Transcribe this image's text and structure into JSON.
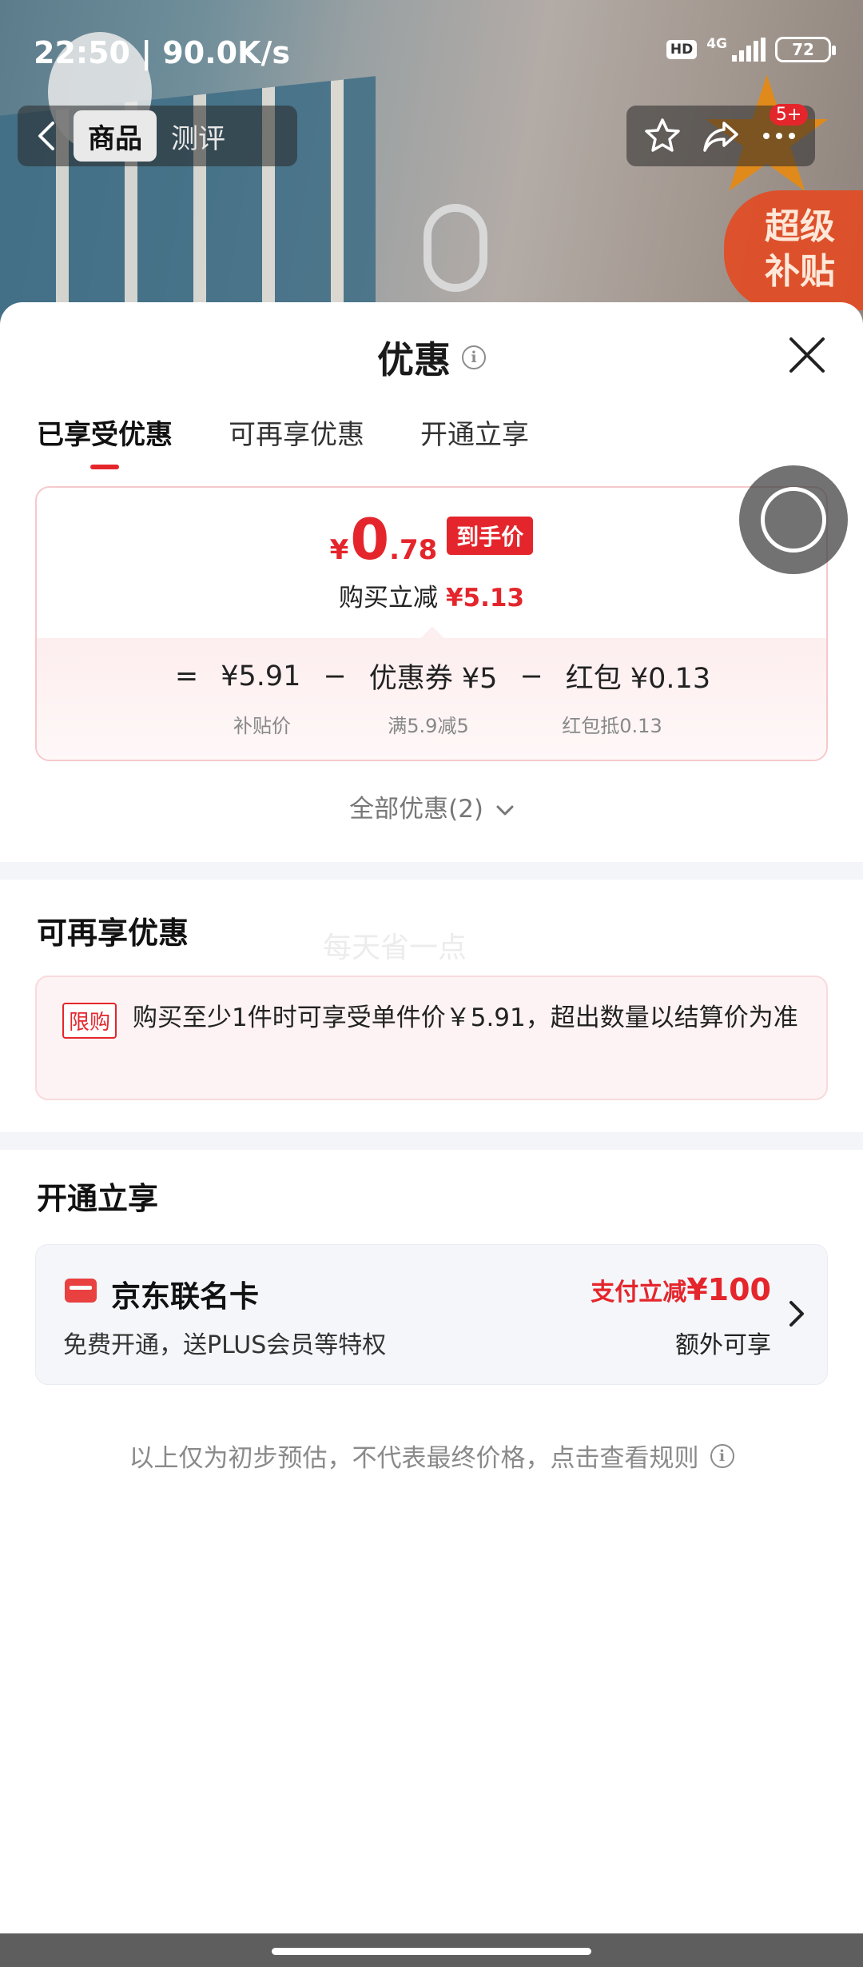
{
  "status_bar": {
    "time": "22:50 | 90.0K/s",
    "hd": "HD",
    "network": "4G",
    "battery": "72"
  },
  "nav": {
    "tab_goods": "商品",
    "tab_review": "测评",
    "message_count": "5+"
  },
  "banner": {
    "super_subsidy_line1": "超级",
    "super_subsidy_line2": "补贴"
  },
  "sheet": {
    "title": "优惠",
    "tabs": [
      "已享受优惠",
      "可再享优惠",
      "开通立享"
    ],
    "price": {
      "currency": "¥",
      "integer": "0",
      "decimal": ".78",
      "badge": "到手价",
      "save_label": "购买立减",
      "save_amount": "¥5.13"
    },
    "formula": {
      "eq": "=",
      "minus": "−",
      "term1": "¥5.91",
      "term1_label": "补贴价",
      "term2": "优惠券 ¥5",
      "term2_label": "满5.9减5",
      "term3": "红包 ¥0.13",
      "term3_label": "红包抵0.13"
    },
    "all_discounts": "全部优惠(2)",
    "more_section": {
      "title": "可再享优惠",
      "watermark": "每天省一点",
      "badge": "限购",
      "text": "购买至少1件时可享受单件价￥5.91，超出数量以结算价为准"
    },
    "open_section": {
      "title": "开通立享",
      "card_name": "京东联名卡",
      "card_desc": "免费开通，送PLUS会员等特权",
      "promo_prefix": "支付立减",
      "promo_amount": "¥100",
      "extra": "额外可享"
    },
    "footnote": "以上仅为初步预估，不代表最终价格，点击查看规则"
  },
  "colors": {
    "accent_red": "#e4262c",
    "divider": "#f4f5f9"
  }
}
